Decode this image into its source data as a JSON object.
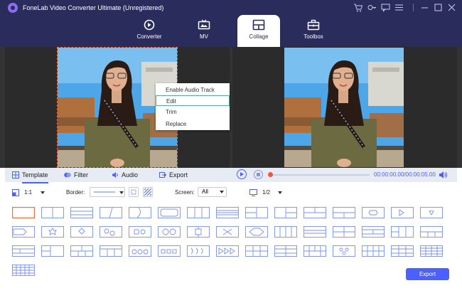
{
  "app": {
    "title": "FoneLab Video Converter Ultimate (Unregistered)"
  },
  "window_controls": [
    "cart-icon",
    "key-icon",
    "chat-icon",
    "menu-icon",
    "minimize-icon",
    "maximize-icon",
    "close-icon"
  ],
  "nav_tabs": [
    {
      "label": "Converter",
      "icon": "converter-icon",
      "active": false
    },
    {
      "label": "MV",
      "icon": "tv-icon",
      "active": false
    },
    {
      "label": "Collage",
      "icon": "collage-icon",
      "active": true
    },
    {
      "label": "Toolbox",
      "icon": "toolbox-icon",
      "active": false
    }
  ],
  "context_menu": {
    "items": [
      {
        "label": "Enable Audio Track",
        "selected": false
      },
      {
        "label": "Edit",
        "selected": true
      },
      {
        "label": "Trim",
        "selected": false
      },
      {
        "label": "Replace",
        "selected": false
      }
    ]
  },
  "tools": [
    {
      "label": "Template",
      "icon": "template-icon",
      "active": true
    },
    {
      "label": "Filter",
      "icon": "filter-icon",
      "active": false
    },
    {
      "label": "Audio",
      "icon": "audio-icon",
      "active": false
    },
    {
      "label": "Export",
      "icon": "export-icon",
      "active": false
    }
  ],
  "player": {
    "time_current": "00:00:00.00",
    "time_total": "00:00:05.00",
    "progress": 0
  },
  "options": {
    "ratio": "1:1",
    "border_label": "Border:",
    "screen_label": "Screen:",
    "screen_value": "All",
    "page_value": "1/2"
  },
  "template_count": 46,
  "export_label": "Export",
  "colors": {
    "titlebar": "#2a2d5c",
    "accent": "#4c5fff",
    "template_stroke": "#7b8ff0",
    "selected_border": "#ff6b3d",
    "workspace": "#333333"
  }
}
